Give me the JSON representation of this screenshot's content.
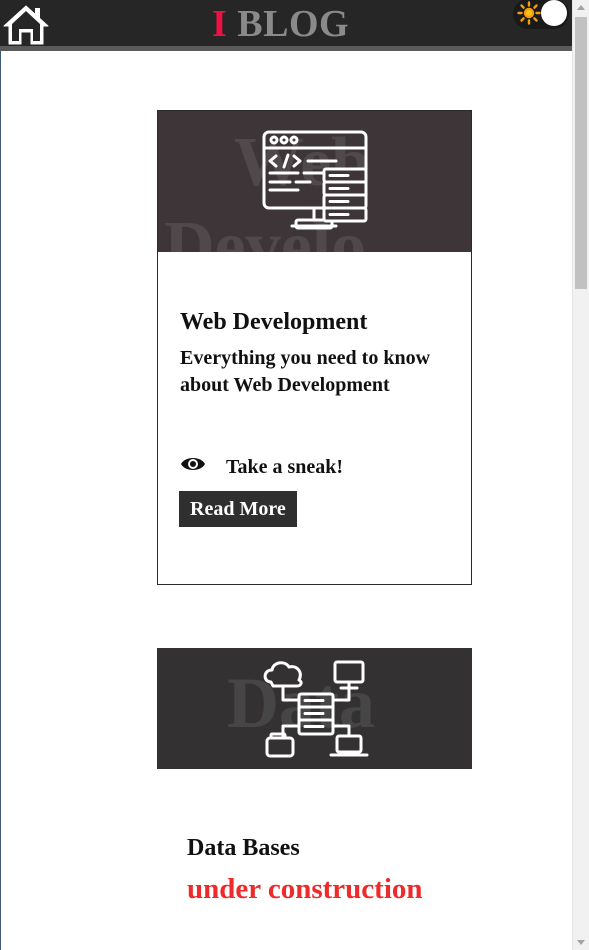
{
  "header": {
    "logo_letter": "I",
    "logo_word": "BLOG",
    "home_icon": "home-icon",
    "theme_icon": "sun-icon"
  },
  "colors": {
    "header_bg": "#262626",
    "logo_accent": "#ee1144",
    "logo_text": "#8a8a8a",
    "card_banner": "#3d3537",
    "button_bg": "#2f2f2f",
    "status_red": "#ee2a2a"
  },
  "posts": [
    {
      "banner_watermark_line1": "Web",
      "banner_watermark_line2": "Develo",
      "banner_icon": "web-code-server-icon",
      "title": "Web Development",
      "description": "Everything you need to know about Web Development",
      "sneak_icon": "eye-icon",
      "sneak_label": "Take a sneak!",
      "read_more_label": "Read More"
    },
    {
      "banner_watermark": "Data",
      "banner_icon": "cloud-database-network-icon",
      "title": "Data Bases",
      "status": "under construction"
    }
  ]
}
